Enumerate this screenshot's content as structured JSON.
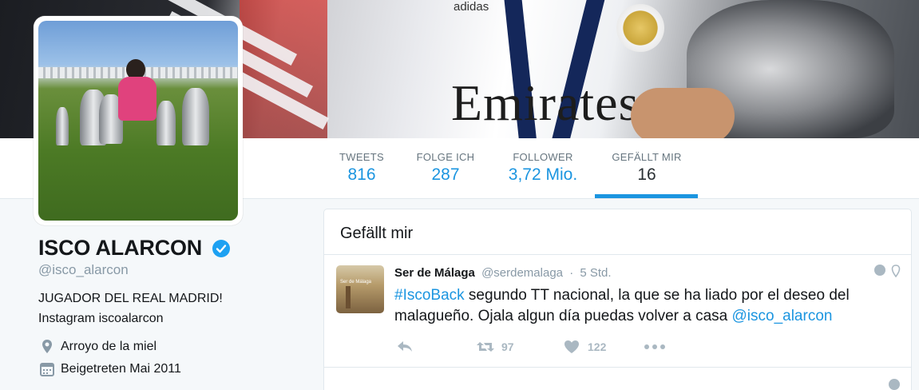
{
  "stats": [
    {
      "label": "TWEETS",
      "value": "816"
    },
    {
      "label": "FOLGE ICH",
      "value": "287"
    },
    {
      "label": "FOLLOWER",
      "value": "3,72 Mio."
    },
    {
      "label": "GEFÄLLT MIR",
      "value": "16"
    }
  ],
  "profile": {
    "name": "ISCO ALARCON",
    "handle": "@isco_alarcon",
    "bio_line1": "JUGADOR DEL REAL MADRID!",
    "bio_line2": "Instagram iscoalarcon",
    "location": "Arroyo de la miel",
    "joined": "Beigetreten Mai 2011"
  },
  "banner": {
    "text_sponsor": "Emirates",
    "text_brand": "adidas"
  },
  "likes_card": {
    "title": "Gefällt mir"
  },
  "tweet": {
    "name": "Ser de Málaga",
    "screen_name": "@serdemalaga",
    "separator": "·",
    "time": "5 Std.",
    "hashtag": "#IscoBack",
    "text_part1": " segundo TT nacional, la que se ha liado por el deseo del malagueño. Ojala algun día puedas volver a casa ",
    "mention": "@isco_alarcon",
    "avatar_text": "Ser de Málaga",
    "retweets": "97",
    "likes": "122"
  },
  "icons": {
    "verified": "verified-badge-icon",
    "location": "map-pin-icon",
    "calendar": "calendar-icon",
    "reply": "reply-icon",
    "retweet": "retweet-icon",
    "like": "heart-icon",
    "more": "more-dots-icon"
  },
  "colors": {
    "accent": "#1b95e0",
    "text": "#14171a",
    "muted": "#8899a6"
  }
}
